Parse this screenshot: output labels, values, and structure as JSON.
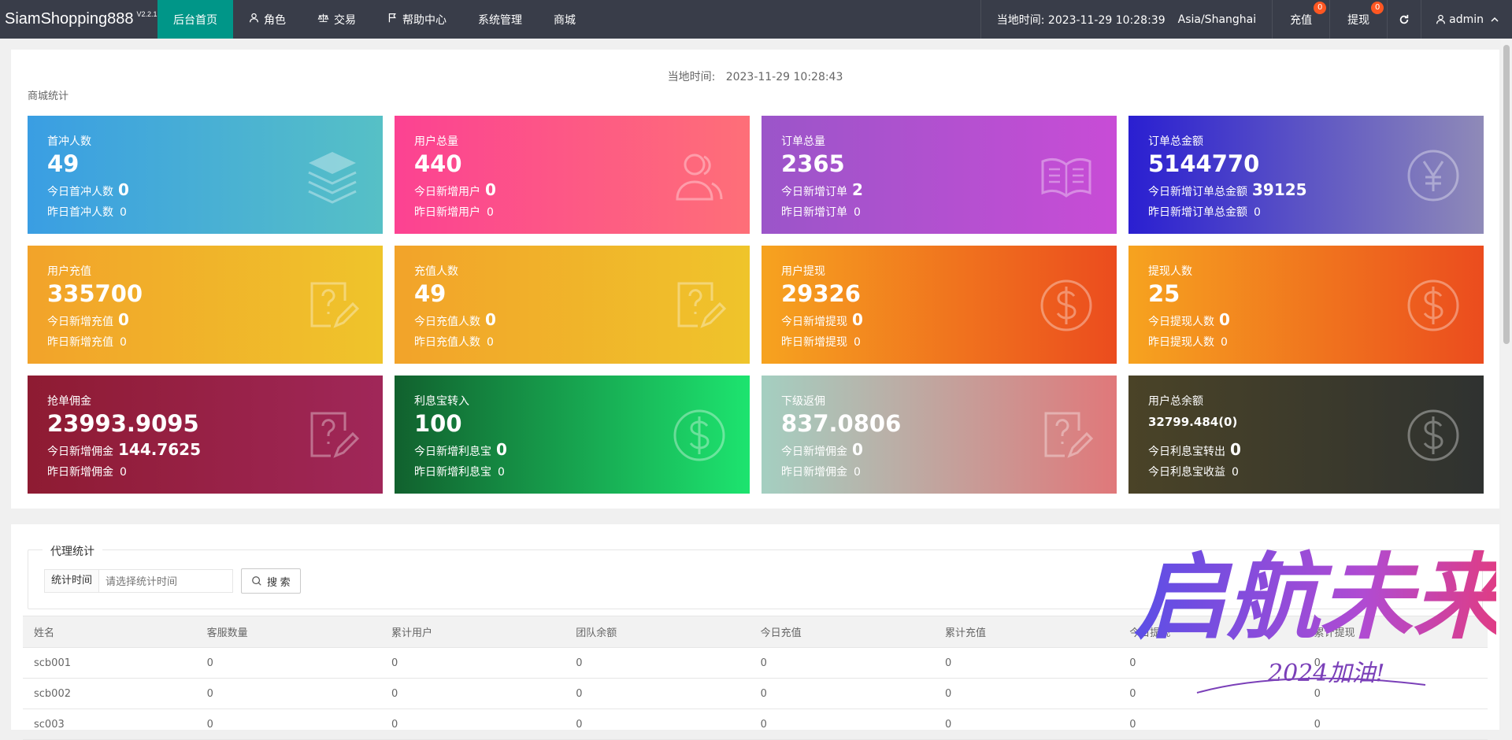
{
  "brand": {
    "name": "SiamShopping888",
    "version": "V2.2.1"
  },
  "nav": [
    {
      "label": "后台首页",
      "icon": "",
      "active": true
    },
    {
      "label": "角色",
      "icon": "user-icon"
    },
    {
      "label": "交易",
      "icon": "scale-icon"
    },
    {
      "label": "帮助中心",
      "icon": "flag-icon"
    },
    {
      "label": "系统管理",
      "icon": ""
    },
    {
      "label": "商城",
      "icon": ""
    }
  ],
  "header": {
    "time_label": "当地时间: 2023-11-29 10:28:39",
    "timezone": "Asia/Shanghai",
    "recharge": {
      "label": "充值",
      "badge": "0"
    },
    "withdraw": {
      "label": "提现",
      "badge": "0"
    },
    "refresh_icon": "refresh-icon",
    "user": "admin"
  },
  "local_time": {
    "label": "当地时间:",
    "value": "2023-11-29 10:28:43"
  },
  "stats_title": "商城统计",
  "cards": [
    {
      "title": "首冲人数",
      "value": "49",
      "a_label": "今日首冲人数",
      "a_value": "0",
      "b_label": "昨日首冲人数",
      "b_value": "0",
      "icon": "layers-icon"
    },
    {
      "title": "用户总量",
      "value": "440",
      "a_label": "今日新增用户",
      "a_value": "0",
      "b_label": "昨日新增用户",
      "b_value": "0",
      "icon": "users-icon"
    },
    {
      "title": "订单总量",
      "value": "2365",
      "a_label": "今日新增订单",
      "a_value": "2",
      "b_label": "昨日新增订单",
      "b_value": "0",
      "icon": "book-icon"
    },
    {
      "title": "订单总金额",
      "value": "5144770",
      "a_label": "今日新增订单总金额",
      "a_value": "39125",
      "b_label": "昨日新增订单总金额",
      "b_value": "0",
      "icon": "yen-icon"
    },
    {
      "title": "用户充值",
      "value": "335700",
      "a_label": "今日新增充值",
      "a_value": "0",
      "b_label": "昨日新增充值",
      "b_value": "0",
      "icon": "edit-question-icon"
    },
    {
      "title": "充值人数",
      "value": "49",
      "a_label": "今日充值人数",
      "a_value": "0",
      "b_label": "昨日充值人数",
      "b_value": "0",
      "icon": "edit-question-icon"
    },
    {
      "title": "用户提现",
      "value": "29326",
      "a_label": "今日新增提现",
      "a_value": "0",
      "b_label": "昨日新增提现",
      "b_value": "0",
      "icon": "dollar-icon"
    },
    {
      "title": "提现人数",
      "value": "25",
      "a_label": "今日提现人数",
      "a_value": "0",
      "b_label": "昨日提现人数",
      "b_value": "0",
      "icon": "dollar-icon"
    },
    {
      "title": "抢单佣金",
      "value": "23993.9095",
      "a_label": "今日新增佣金",
      "a_value": "144.7625",
      "b_label": "昨日新增佣金",
      "b_value": "0",
      "icon": "edit-question-icon"
    },
    {
      "title": "利息宝转入",
      "value": "100",
      "a_label": "今日新增利息宝",
      "a_value": "0",
      "b_label": "昨日新增利息宝",
      "b_value": "0",
      "icon": "dollar-icon"
    },
    {
      "title": "下级返佣",
      "value": "837.0806",
      "a_label": "今日新增佣金",
      "a_value": "0",
      "b_label": "昨日新增佣金",
      "b_value": "0",
      "icon": "edit-question-icon"
    },
    {
      "title": "用户总余额",
      "value": "32799.484(0)",
      "a_label": "今日利息宝转出",
      "a_value": "0",
      "b_label": "今日利息宝收益",
      "b_value": "0",
      "icon": "dollar-icon"
    }
  ],
  "card_gradients": [
    "linear-gradient(90deg,#3a9ee3,#56c0c6)",
    "linear-gradient(90deg,#fc4292,#fe6f78)",
    "linear-gradient(90deg,#9b55c9,#c84cd6)",
    "linear-gradient(90deg,#2a1fd1,#8f8ab8)",
    "linear-gradient(90deg,#f2a32a,#efc42b)",
    "linear-gradient(90deg,#f2a32a,#efc42b)",
    "linear-gradient(90deg,#f6a31f,#eb4c1e)",
    "linear-gradient(90deg,#f6a31f,#eb4c1e)",
    "linear-gradient(90deg,#8e1b32,#a02759)",
    "linear-gradient(90deg,#11612e,#1de46f)",
    "linear-gradient(90deg,#a4cfc1,#e0787a)",
    "linear-gradient(90deg,#4a4327,#2f3230)"
  ],
  "agent": {
    "legend": "代理统计",
    "filter_label": "统计时间",
    "filter_placeholder": "请选择统计时间",
    "search_button": "搜 索",
    "columns": [
      "姓名",
      "客服数量",
      "累计用户",
      "团队余额",
      "今日充值",
      "累计充值",
      "今日提现",
      "累计提现"
    ],
    "rows": [
      [
        "scb001",
        "0",
        "0",
        "0",
        "0",
        "0",
        "0",
        "0"
      ],
      [
        "scb002",
        "0",
        "0",
        "0",
        "0",
        "0",
        "0",
        "0"
      ],
      [
        "sc003",
        "0",
        "0",
        "0",
        "0",
        "0",
        "0",
        "0"
      ]
    ]
  },
  "watermark": {
    "title": "启航未来",
    "subtitle": "2024加油!"
  }
}
